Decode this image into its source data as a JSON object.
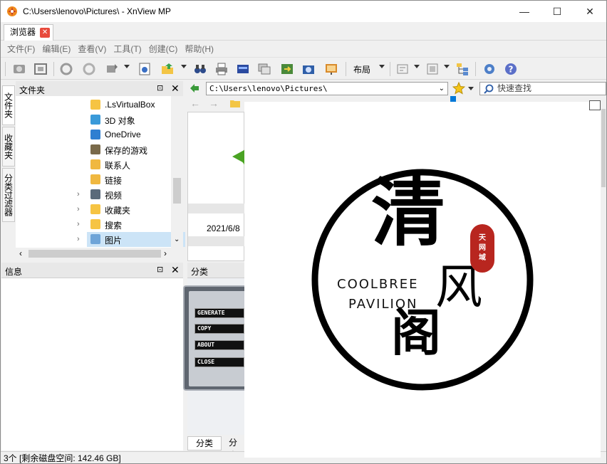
{
  "window": {
    "title": "C:\\Users\\lenovo\\Pictures\\ - XnView MP",
    "minimize": "—",
    "maximize": "☐",
    "close": "✕"
  },
  "tabs": [
    {
      "label": "浏览器",
      "close": "✕"
    }
  ],
  "menu": [
    "文件(F)",
    "编辑(E)",
    "查看(V)",
    "工具(T)",
    "创建(C)",
    "帮助(H)"
  ],
  "toolbar": {
    "layout_label": "布局"
  },
  "side_tabs": [
    "文件夹",
    "收藏夹",
    "分类过滤器"
  ],
  "folder_panel": {
    "title": "文件夹",
    "pin": "⊡",
    "close": "✕",
    "items": [
      {
        "label": ".LsVirtualBox",
        "expand": "",
        "icon": "folder-icon",
        "color": "#f6c443"
      },
      {
        "label": "3D 对象",
        "expand": "",
        "icon": "3d-objects-icon",
        "color": "#3a9ad9"
      },
      {
        "label": "OneDrive",
        "expand": "",
        "icon": "onedrive-icon",
        "color": "#2f7fd1"
      },
      {
        "label": "保存的游戏",
        "expand": "",
        "icon": "saved-games-icon",
        "color": "#7a6a4a"
      },
      {
        "label": "联系人",
        "expand": "",
        "icon": "contacts-icon",
        "color": "#f0b840"
      },
      {
        "label": "链接",
        "expand": "",
        "icon": "links-icon",
        "color": "#f0b840"
      },
      {
        "label": "视频",
        "expand": "›",
        "icon": "videos-icon",
        "color": "#5a6a7a"
      },
      {
        "label": "收藏夹",
        "expand": "›",
        "icon": "favorites-icon",
        "color": "#f6c443"
      },
      {
        "label": "搜索",
        "expand": "›",
        "icon": "searches-icon",
        "color": "#f6c443"
      },
      {
        "label": "图片",
        "expand": "›",
        "icon": "pictures-icon",
        "color": "#6ea4d8"
      }
    ]
  },
  "info_panel": {
    "title": "信息",
    "pin": "⊡",
    "close": "✕"
  },
  "category_panel": {
    "title": "分类",
    "bottom_tabs": [
      "分类",
      "分类"
    ],
    "menu_buttons": [
      "GENERATE",
      "COPY",
      "ABOUT",
      "CLOSE"
    ]
  },
  "address": {
    "path": "C:\\Users\\lenovo\\Pictures\\",
    "search_placeholder": "快速查找"
  },
  "browser": {
    "thumb_date": "2021/6/8"
  },
  "status": {
    "text": "3个 [剩余磁盘空间: 142.46 GB]"
  },
  "preview": {
    "logo_char_1": "清",
    "logo_char_2": "风",
    "logo_char_3": "阁",
    "logo_en_1": "COOLBREE",
    "logo_en_2": "PAVILION",
    "seal": [
      "天",
      "网",
      "域"
    ]
  }
}
